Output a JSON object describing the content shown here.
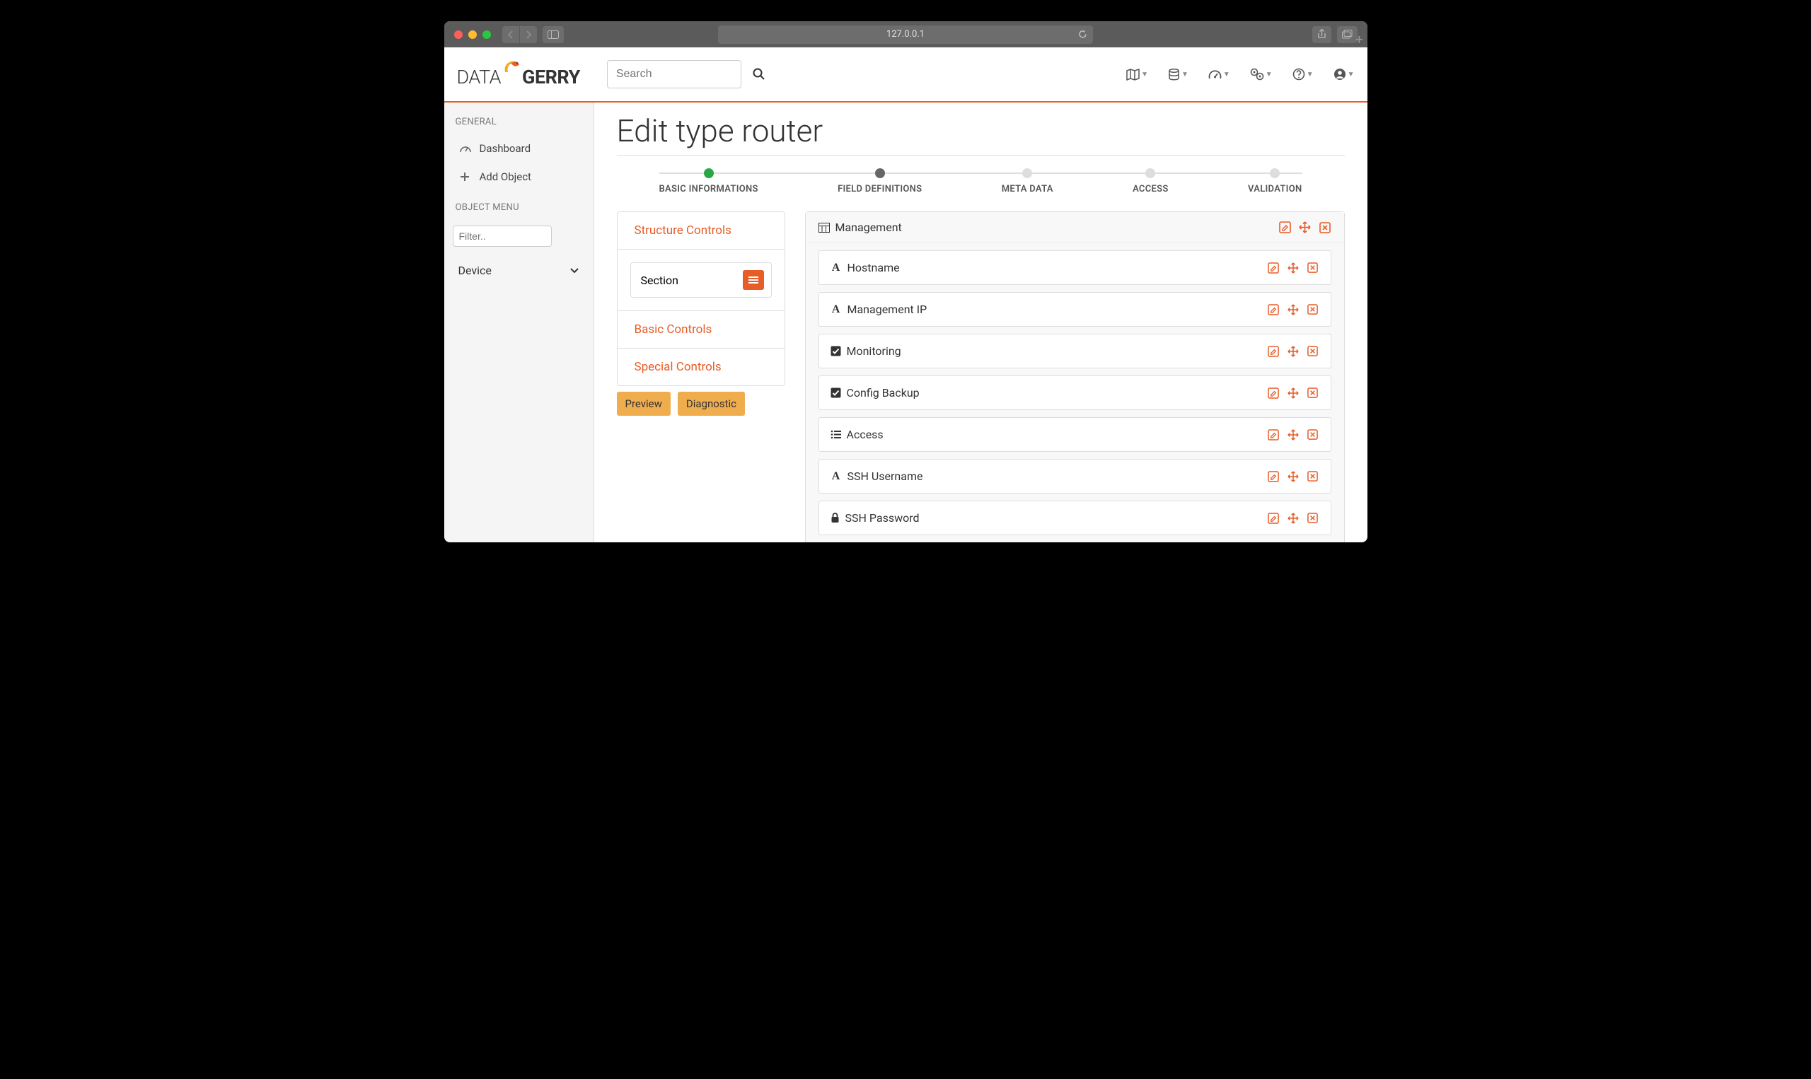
{
  "browser": {
    "url": "127.0.0.1"
  },
  "logo": {
    "part1": "DATA",
    "part2": "GERRY"
  },
  "search": {
    "placeholder": "Search"
  },
  "sidebar": {
    "general_title": "GENERAL",
    "dashboard": "Dashboard",
    "add_object": "Add Object",
    "object_menu_title": "OBJECT MENU",
    "filter_placeholder": "Filter..",
    "device": "Device"
  },
  "page": {
    "title": "Edit type router"
  },
  "stepper": {
    "s1": "BASIC INFORMATIONS",
    "s2": "FIELD DEFINITIONS",
    "s3": "META DATA",
    "s4": "ACCESS",
    "s5": "VALIDATION"
  },
  "controls": {
    "structure": "Structure Controls",
    "section_label": "Section",
    "basic": "Basic Controls",
    "special": "Special Controls",
    "preview": "Preview",
    "diagnostic": "Diagnostic"
  },
  "section": {
    "name": "Management",
    "fields": [
      {
        "icon": "text",
        "label": "Hostname"
      },
      {
        "icon": "text",
        "label": "Management IP"
      },
      {
        "icon": "check",
        "label": "Monitoring"
      },
      {
        "icon": "check",
        "label": "Config Backup"
      },
      {
        "icon": "list",
        "label": "Access"
      },
      {
        "icon": "text",
        "label": "SSH Username"
      },
      {
        "icon": "lock",
        "label": "SSH Password"
      }
    ]
  }
}
